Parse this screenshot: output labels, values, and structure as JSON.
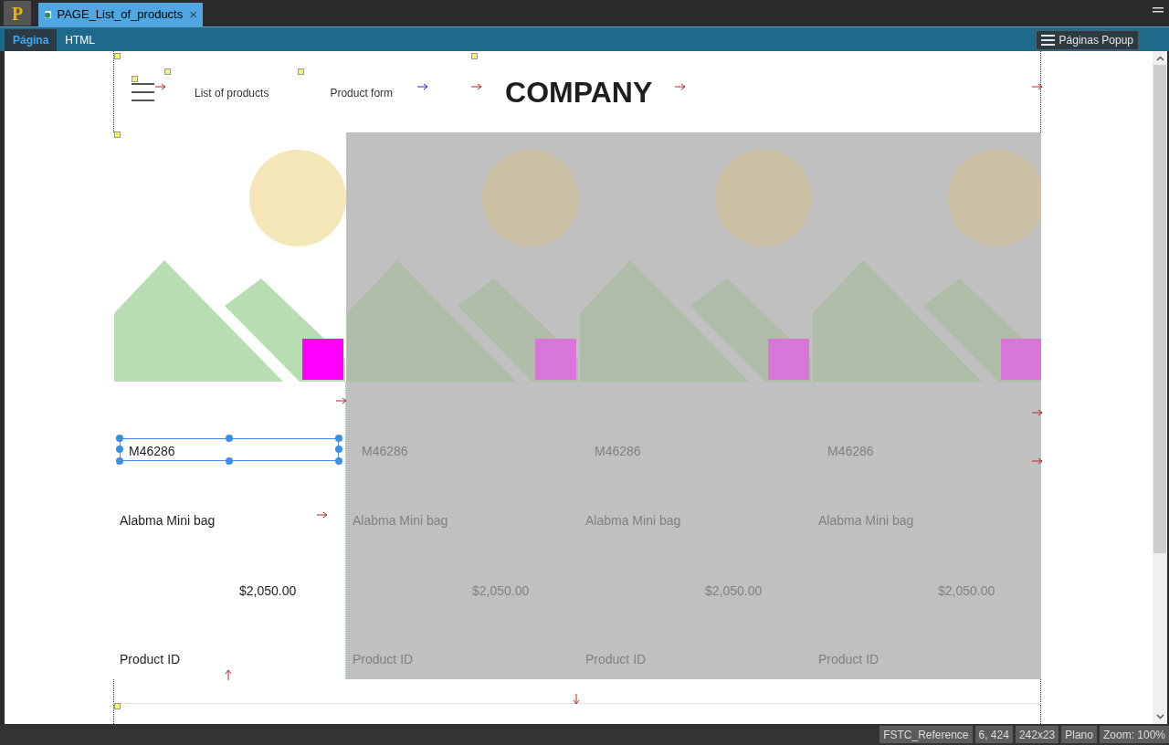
{
  "app": {
    "logo": "P",
    "document_tab": {
      "title": "PAGE_List_of_products",
      "close": "×"
    }
  },
  "editor_tabs": [
    {
      "label": "Página",
      "selected": true
    },
    {
      "label": "HTML",
      "selected": false
    }
  ],
  "popup_button": {
    "label": "Páginas Popup"
  },
  "page": {
    "nav": [
      "List of products",
      "Product form"
    ],
    "company": "COMPANY",
    "cards": [
      {
        "id": "M46286",
        "name": "Alabma Mini bag",
        "price": "$2,050.00",
        "label": "Product ID",
        "dimmed": false,
        "selected": true
      },
      {
        "id": "M46286",
        "name": "Alabma Mini bag",
        "price": "$2,050.00",
        "label": "Product ID",
        "dimmed": true,
        "selected": false
      },
      {
        "id": "M46286",
        "name": "Alabma Mini bag",
        "price": "$2,050.00",
        "label": "Product ID",
        "dimmed": true,
        "selected": false
      },
      {
        "id": "M46286",
        "name": "Alabma Mini bag",
        "price": "$2,050.00",
        "label": "Product ID",
        "dimmed": true,
        "selected": false
      }
    ]
  },
  "status_bar": [
    "FSTC_Reference",
    "6, 424",
    "242x23",
    "Plano",
    "Zoom: 100%"
  ]
}
